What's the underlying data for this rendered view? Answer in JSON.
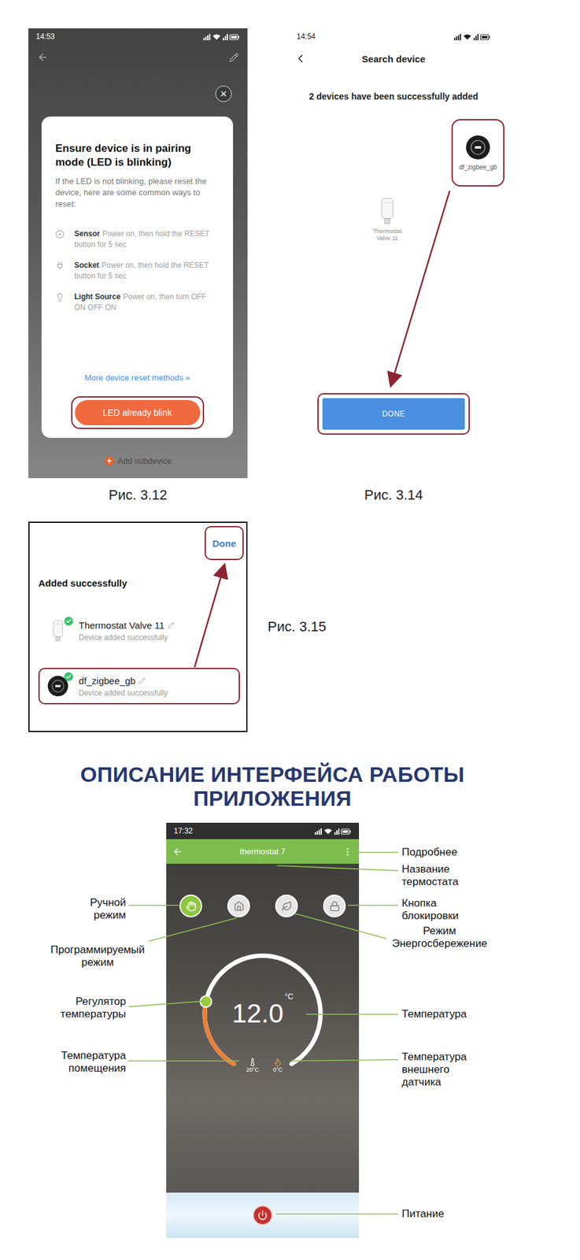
{
  "fig_3_12": {
    "status_time": "14:53",
    "dialog": {
      "close": "×",
      "title": "Ensure device is in pairing mode (LED is blinking)",
      "text": "If the LED is not blinking, please reset the device, here are some common ways to reset:",
      "methods": [
        {
          "name": "Sensor",
          "desc": "Power on, then hold the RESET button for 5 sec"
        },
        {
          "name": "Socket",
          "desc": "Power on, then hold the RESET button for 5 sec"
        },
        {
          "name": "Light Source",
          "desc": "Power on, then turn OFF ON OFF ON"
        }
      ],
      "link": "More device reset methods »",
      "button": "LED already blink"
    },
    "footer": "Add subdevice",
    "caption": "Рис. 3.12"
  },
  "fig_3_14": {
    "status_time": "14:54",
    "title": "Search device",
    "message": "2 devices have been successfully added",
    "devices": [
      {
        "name": "df_zigbee_gb",
        "kind": "gateway",
        "highlighted": true
      },
      {
        "name": "Thermostat Valve 11",
        "kind": "valve",
        "highlighted": false
      }
    ],
    "button": "DONE",
    "caption": "Рис. 3.14"
  },
  "fig_3_15": {
    "done": "Done",
    "title": "Added successfully",
    "devices": [
      {
        "name": "Thermostat Valve 11",
        "kind": "valve",
        "status": "Device added successfully",
        "highlighted": false
      },
      {
        "name": "df_zigbee_gb",
        "kind": "gateway",
        "status": "Device added successfully",
        "highlighted": true
      }
    ],
    "caption": "Рис. 3.15"
  },
  "heading": [
    "ОПИСАНИЕ ИНТЕРФЕЙСА РАБОТЫ",
    "ПРИЛОЖЕНИЯ"
  ],
  "app": {
    "status_time": "17:32",
    "title": "thermostat 7",
    "modes": [
      {
        "kind": "manual",
        "selected": true
      },
      {
        "kind": "program",
        "selected": false
      },
      {
        "kind": "eco",
        "selected": false
      },
      {
        "kind": "lock",
        "selected": false
      }
    ],
    "setpoint": "12.0",
    "unit": "°C",
    "level": 0.24,
    "room_temperature": "20°C",
    "external_temperature": "0°C"
  },
  "annotations": {
    "more": [
      "Подробнее"
    ],
    "title": [
      "Название",
      "термостата"
    ],
    "lock": [
      "Кнопка",
      "блокировки"
    ],
    "eco": [
      "Режим",
      "Энергосбережение"
    ],
    "temperature": [
      "Температура"
    ],
    "external": [
      "Температура",
      "внешнего",
      "датчика"
    ],
    "power": [
      "Питание"
    ],
    "manual": [
      "Ручной",
      "режим"
    ],
    "program": [
      "Программируемый",
      "режим"
    ],
    "regulator": [
      "Регулятор",
      "температуры"
    ],
    "room": [
      "Температура",
      "помещения"
    ]
  }
}
